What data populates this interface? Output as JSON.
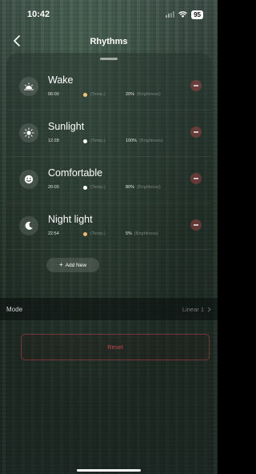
{
  "status_bar": {
    "time": "10:42",
    "battery": "95",
    "icons": [
      "signal-icon",
      "wifi-icon",
      "battery-icon"
    ]
  },
  "nav": {
    "title": "Rhythms",
    "back_icon": "chevron-left-icon"
  },
  "rhythms": [
    {
      "name": "Wake",
      "time": "06:00",
      "temp_label": "(Temp.)",
      "brightness": "20%",
      "brightness_label": "(Brightness)",
      "icon": "sunrise-icon",
      "dot_color": "#f6c57a"
    },
    {
      "name": "Sunlight",
      "time": "12:28",
      "temp_label": "(Temp.)",
      "brightness": "100%",
      "brightness_label": "(Brightness)",
      "icon": "sun-icon",
      "dot_color": "#ffffff"
    },
    {
      "name": "Comfortable",
      "time": "20:00",
      "temp_label": "(Temp.)",
      "brightness": "80%",
      "brightness_label": "(Brightness)",
      "icon": "smile-icon",
      "dot_color": "#ffffff"
    },
    {
      "name": "Night light",
      "time": "22:54",
      "temp_label": "(Temp.)",
      "brightness": "5%",
      "brightness_label": "(Brightness)",
      "icon": "moon-icon",
      "dot_color": "#f3b873"
    }
  ],
  "add_new": {
    "label": "Add New",
    "icon": "plus-icon"
  },
  "mode": {
    "label": "Mode",
    "value": "Linear 1",
    "icon": "chevron-right-icon"
  },
  "reset": {
    "label": "Reset"
  },
  "colors": {
    "danger": "#c0474a",
    "background": "#233229"
  }
}
